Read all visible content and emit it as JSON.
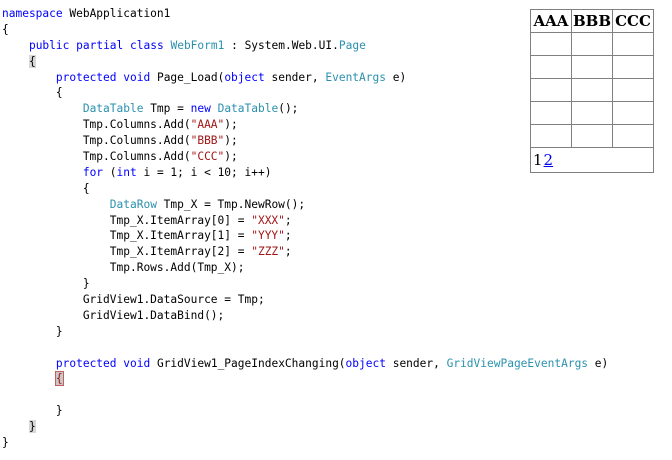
{
  "code_lines": [
    [
      {
        "t": "namespace",
        "c": "kw"
      },
      {
        "t": " WebApplication1"
      }
    ],
    [
      {
        "t": "{"
      }
    ],
    [
      {
        "t": "    "
      },
      {
        "t": "public",
        "c": "kw"
      },
      {
        "t": " "
      },
      {
        "t": "partial",
        "c": "kw"
      },
      {
        "t": " "
      },
      {
        "t": "class",
        "c": "kw"
      },
      {
        "t": " "
      },
      {
        "t": "WebForm1",
        "c": "ty"
      },
      {
        "t": " : System.Web.UI."
      },
      {
        "t": "Page",
        "c": "ty"
      }
    ],
    [
      {
        "t": "    "
      },
      {
        "t": "{",
        "c": "brace-hl"
      }
    ],
    [
      {
        "t": "        "
      },
      {
        "t": "protected",
        "c": "kw"
      },
      {
        "t": " "
      },
      {
        "t": "void",
        "c": "kw"
      },
      {
        "t": " Page_Load("
      },
      {
        "t": "object",
        "c": "kw"
      },
      {
        "t": " sender, "
      },
      {
        "t": "EventArgs",
        "c": "ty"
      },
      {
        "t": " e)"
      }
    ],
    [
      {
        "t": "        {"
      }
    ],
    [
      {
        "t": "            "
      },
      {
        "t": "DataTable",
        "c": "ty"
      },
      {
        "t": " Tmp = "
      },
      {
        "t": "new",
        "c": "kw"
      },
      {
        "t": " "
      },
      {
        "t": "DataTable",
        "c": "ty"
      },
      {
        "t": "();"
      }
    ],
    [
      {
        "t": "            Tmp.Columns.Add("
      },
      {
        "t": "\"AAA\"",
        "c": "str"
      },
      {
        "t": ");"
      }
    ],
    [
      {
        "t": "            Tmp.Columns.Add("
      },
      {
        "t": "\"BBB\"",
        "c": "str"
      },
      {
        "t": ");"
      }
    ],
    [
      {
        "t": "            Tmp.Columns.Add("
      },
      {
        "t": "\"CCC\"",
        "c": "str"
      },
      {
        "t": ");"
      }
    ],
    [
      {
        "t": "            "
      },
      {
        "t": "for",
        "c": "kw"
      },
      {
        "t": " ("
      },
      {
        "t": "int",
        "c": "kw"
      },
      {
        "t": " i = 1; i < 10; i++)"
      }
    ],
    [
      {
        "t": "            {"
      }
    ],
    [
      {
        "t": "                "
      },
      {
        "t": "DataRow",
        "c": "ty"
      },
      {
        "t": " Tmp_X = Tmp.NewRow();"
      }
    ],
    [
      {
        "t": "                Tmp_X.ItemArray[0] = "
      },
      {
        "t": "\"XXX\"",
        "c": "str"
      },
      {
        "t": ";"
      }
    ],
    [
      {
        "t": "                Tmp_X.ItemArray[1] = "
      },
      {
        "t": "\"YYY\"",
        "c": "str"
      },
      {
        "t": ";"
      }
    ],
    [
      {
        "t": "                Tmp_X.ItemArray[2] = "
      },
      {
        "t": "\"ZZZ\"",
        "c": "str"
      },
      {
        "t": ";"
      }
    ],
    [
      {
        "t": "                Tmp.Rows.Add(Tmp_X);"
      }
    ],
    [
      {
        "t": "            }"
      }
    ],
    [
      {
        "t": "            GridView1.DataSource = Tmp;"
      }
    ],
    [
      {
        "t": "            GridView1.DataBind();"
      }
    ],
    [
      {
        "t": "        }"
      }
    ],
    [
      {
        "t": ""
      }
    ],
    [
      {
        "t": "        "
      },
      {
        "t": "protected",
        "c": "kw"
      },
      {
        "t": " "
      },
      {
        "t": "void",
        "c": "kw"
      },
      {
        "t": " GridView1_PageIndexChanging("
      },
      {
        "t": "object",
        "c": "kw"
      },
      {
        "t": " sender, "
      },
      {
        "t": "GridViewPageEventArgs",
        "c": "ty"
      },
      {
        "t": " e)"
      }
    ],
    [
      {
        "t": "        "
      },
      {
        "t": "{",
        "c": "brace-red"
      }
    ],
    [
      {
        "t": ""
      }
    ],
    [
      {
        "t": "        }"
      }
    ],
    [
      {
        "t": "    "
      },
      {
        "t": "}",
        "c": "brace-hl"
      }
    ],
    [
      {
        "t": "}"
      }
    ]
  ],
  "grid": {
    "headers": [
      "AAA",
      "BBB",
      "CCC"
    ],
    "rows": [
      [
        "",
        "",
        ""
      ],
      [
        "",
        "",
        ""
      ],
      [
        "",
        "",
        ""
      ],
      [
        "",
        "",
        ""
      ],
      [
        "",
        "",
        ""
      ]
    ],
    "pager": {
      "current": "1",
      "link": "2"
    }
  }
}
